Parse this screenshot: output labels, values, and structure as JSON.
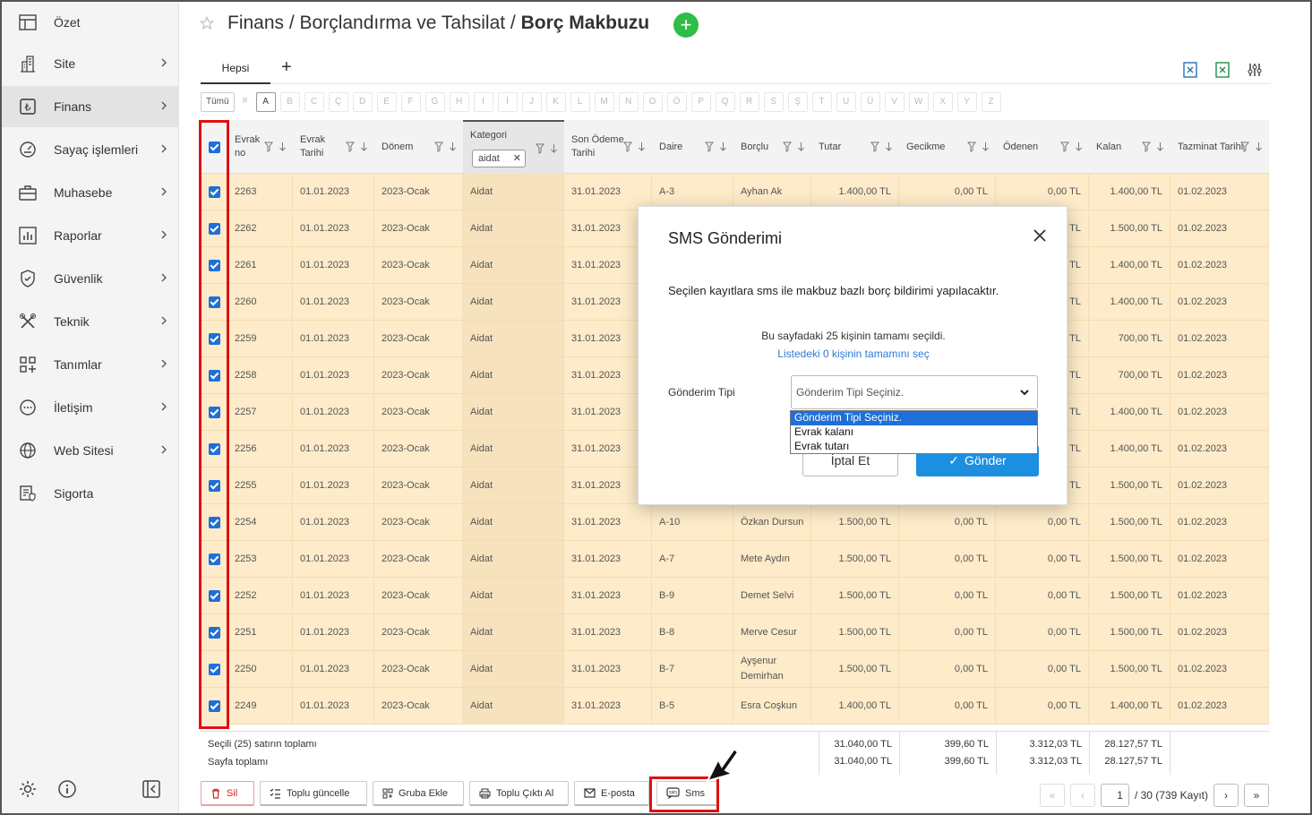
{
  "sidebar": {
    "items": [
      {
        "label": "Özet",
        "icon": "table-icon",
        "chevron": false,
        "active": false
      },
      {
        "label": "Site",
        "icon": "building-icon",
        "chevron": true,
        "active": false
      },
      {
        "label": "Finans",
        "icon": "lira-icon",
        "chevron": true,
        "active": true
      },
      {
        "label": "Sayaç işlemleri",
        "icon": "gauge-icon",
        "chevron": true,
        "active": false
      },
      {
        "label": "Muhasebe",
        "icon": "briefcase-icon",
        "chevron": true,
        "active": false
      },
      {
        "label": "Raporlar",
        "icon": "chart-icon",
        "chevron": true,
        "active": false
      },
      {
        "label": "Güvenlik",
        "icon": "shield-icon",
        "chevron": true,
        "active": false
      },
      {
        "label": "Teknik",
        "icon": "tools-icon",
        "chevron": true,
        "active": false
      },
      {
        "label": "Tanımlar",
        "icon": "grid-plus-icon",
        "chevron": true,
        "active": false
      },
      {
        "label": "İletişim",
        "icon": "chat-icon",
        "chevron": true,
        "active": false
      },
      {
        "label": "Web Sitesi",
        "icon": "globe-icon",
        "chevron": true,
        "active": false
      },
      {
        "label": "Sigorta",
        "icon": "insurance-icon",
        "chevron": false,
        "active": false
      }
    ]
  },
  "header": {
    "breadcrumb": "Finans / Borçlandırma ve Tahsilat / ",
    "current": "Borç Makbuzu",
    "add_symbol": "+"
  },
  "tabs": {
    "active": "Hepsi",
    "add": "+"
  },
  "letters": {
    "all": "Tümü",
    "hash": "#",
    "items": [
      "A",
      "B",
      "C",
      "Ç",
      "D",
      "E",
      "F",
      "G",
      "H",
      "I",
      "İ",
      "J",
      "K",
      "L",
      "M",
      "N",
      "O",
      "Ö",
      "P",
      "Q",
      "R",
      "S",
      "Ş",
      "T",
      "U",
      "Ü",
      "V",
      "W",
      "X",
      "Y",
      "Z"
    ]
  },
  "columns": {
    "evrak_no": "Evrak no",
    "evrak_tarihi": "Evrak Tarihi",
    "donem": "Dönem",
    "kategori": "Kategori",
    "kategori_filter": "aidat",
    "son_odeme": "Son Ödeme Tarihi",
    "daire": "Daire",
    "borclu": "Borçlu",
    "tutar": "Tutar",
    "gecikme": "Gecikme",
    "odenen": "Ödenen",
    "kalan": "Kalan",
    "tazminat": "Tazminat Tarihi"
  },
  "rows": [
    {
      "no": "2263",
      "tarih": "01.01.2023",
      "donem": "2023-Ocak",
      "kategori": "Aidat",
      "son": "31.01.2023",
      "daire": "A-3",
      "borclu": "Ayhan Ak",
      "tutar": "1.400,00 TL",
      "gecikme": "0,00 TL",
      "odenen": "0,00 TL",
      "kalan": "1.400,00 TL",
      "tazminat": "01.02.2023"
    },
    {
      "no": "2262",
      "tarih": "01.01.2023",
      "donem": "2023-Ocak",
      "kategori": "Aidat",
      "son": "31.01.2023",
      "daire": "",
      "borclu": "",
      "tutar": "",
      "gecikme": "",
      "odenen": "TL",
      "kalan": "1.500,00 TL",
      "tazminat": "01.02.2023"
    },
    {
      "no": "2261",
      "tarih": "01.01.2023",
      "donem": "2023-Ocak",
      "kategori": "Aidat",
      "son": "31.01.2023",
      "daire": "",
      "borclu": "",
      "tutar": "",
      "gecikme": "",
      "odenen": "TL",
      "kalan": "1.400,00 TL",
      "tazminat": "01.02.2023"
    },
    {
      "no": "2260",
      "tarih": "01.01.2023",
      "donem": "2023-Ocak",
      "kategori": "Aidat",
      "son": "31.01.2023",
      "daire": "",
      "borclu": "",
      "tutar": "",
      "gecikme": "",
      "odenen": "TL",
      "kalan": "1.400,00 TL",
      "tazminat": "01.02.2023"
    },
    {
      "no": "2259",
      "tarih": "01.01.2023",
      "donem": "2023-Ocak",
      "kategori": "Aidat",
      "son": "31.01.2023",
      "daire": "",
      "borclu": "",
      "tutar": "",
      "gecikme": "",
      "odenen": "TL",
      "kalan": "700,00 TL",
      "tazminat": "01.02.2023"
    },
    {
      "no": "2258",
      "tarih": "01.01.2023",
      "donem": "2023-Ocak",
      "kategori": "Aidat",
      "son": "31.01.2023",
      "daire": "",
      "borclu": "",
      "tutar": "",
      "gecikme": "",
      "odenen": "TL",
      "kalan": "700,00 TL",
      "tazminat": "01.02.2023"
    },
    {
      "no": "2257",
      "tarih": "01.01.2023",
      "donem": "2023-Ocak",
      "kategori": "Aidat",
      "son": "31.01.2023",
      "daire": "",
      "borclu": "",
      "tutar": "",
      "gecikme": "",
      "odenen": "TL",
      "kalan": "1.400,00 TL",
      "tazminat": "01.02.2023"
    },
    {
      "no": "2256",
      "tarih": "01.01.2023",
      "donem": "2023-Ocak",
      "kategori": "Aidat",
      "son": "31.01.2023",
      "daire": "",
      "borclu": "",
      "tutar": "",
      "gecikme": "",
      "odenen": "TL",
      "kalan": "1.400,00 TL",
      "tazminat": "01.02.2023"
    },
    {
      "no": "2255",
      "tarih": "01.01.2023",
      "donem": "2023-Ocak",
      "kategori": "Aidat",
      "son": "31.01.2023",
      "daire": "",
      "borclu": "",
      "tutar": "",
      "gecikme": "",
      "odenen": "TL",
      "kalan": "1.500,00 TL",
      "tazminat": "01.02.2023"
    },
    {
      "no": "2254",
      "tarih": "01.01.2023",
      "donem": "2023-Ocak",
      "kategori": "Aidat",
      "son": "31.01.2023",
      "daire": "A-10",
      "borclu": "Özkan Dursun",
      "tutar": "1.500,00 TL",
      "gecikme": "0,00 TL",
      "odenen": "0,00 TL",
      "kalan": "1.500,00 TL",
      "tazminat": "01.02.2023"
    },
    {
      "no": "2253",
      "tarih": "01.01.2023",
      "donem": "2023-Ocak",
      "kategori": "Aidat",
      "son": "31.01.2023",
      "daire": "A-7",
      "borclu": "Mete Aydın",
      "tutar": "1.500,00 TL",
      "gecikme": "0,00 TL",
      "odenen": "0,00 TL",
      "kalan": "1.500,00 TL",
      "tazminat": "01.02.2023"
    },
    {
      "no": "2252",
      "tarih": "01.01.2023",
      "donem": "2023-Ocak",
      "kategori": "Aidat",
      "son": "31.01.2023",
      "daire": "B-9",
      "borclu": "Demet Selvi",
      "tutar": "1.500,00 TL",
      "gecikme": "0,00 TL",
      "odenen": "0,00 TL",
      "kalan": "1.500,00 TL",
      "tazminat": "01.02.2023"
    },
    {
      "no": "2251",
      "tarih": "01.01.2023",
      "donem": "2023-Ocak",
      "kategori": "Aidat",
      "son": "31.01.2023",
      "daire": "B-8",
      "borclu": "Merve Cesur",
      "tutar": "1.500,00 TL",
      "gecikme": "0,00 TL",
      "odenen": "0,00 TL",
      "kalan": "1.500,00 TL",
      "tazminat": "01.02.2023"
    },
    {
      "no": "2250",
      "tarih": "01.01.2023",
      "donem": "2023-Ocak",
      "kategori": "Aidat",
      "son": "31.01.2023",
      "daire": "B-7",
      "borclu": "Ayşenur Demirhan",
      "tutar": "1.500,00 TL",
      "gecikme": "0,00 TL",
      "odenen": "0,00 TL",
      "kalan": "1.500,00 TL",
      "tazminat": "01.02.2023"
    },
    {
      "no": "2249",
      "tarih": "01.01.2023",
      "donem": "2023-Ocak",
      "kategori": "Aidat",
      "son": "31.01.2023",
      "daire": "B-5",
      "borclu": "Esra Coşkun",
      "tutar": "1.400,00 TL",
      "gecikme": "0,00 TL",
      "odenen": "0,00 TL",
      "kalan": "1.400,00 TL",
      "tazminat": "01.02.2023"
    }
  ],
  "totals": {
    "selected_label": "Seçili (25) satırın toplamı",
    "page_label": "Sayfa toplamı",
    "selected": {
      "tutar": "31.040,00 TL",
      "gecikme": "399,60 TL",
      "odenen": "3.312,03 TL",
      "kalan": "28.127,57 TL"
    },
    "page": {
      "tutar": "31.040,00 TL",
      "gecikme": "399,60 TL",
      "odenen": "3.312,03 TL",
      "kalan": "28.127,57 TL"
    }
  },
  "toolbar": {
    "sil": "Sil",
    "toplu_guncelle": "Toplu güncelle",
    "gruba_ekle": "Gruba Ekle",
    "toplu_cikti": "Toplu Çıktı Al",
    "eposta": "E-posta",
    "sms": "Sms"
  },
  "pager": {
    "page": "1",
    "info": "/ 30 (739 Kayıt)"
  },
  "modal": {
    "title": "SMS Gönderimi",
    "message": "Seçilen kayıtlara sms ile makbuz bazlı borç bildirimi yapılacaktır.",
    "info": "Bu sayfadaki 25 kişinin tamamı seçildi.",
    "link": "Listedeki 0 kişinin tamamını seç",
    "type_label": "Gönderim Tipi",
    "select_value": "Gönderim Tipi Seçiniz.",
    "options": [
      "Gönderim Tipi Seçiniz.",
      "Evrak kalanı",
      "Evrak tutarı"
    ],
    "cancel": "İptal Et",
    "send": "Gönder"
  },
  "colors": {
    "row_bg": "#fdebc9",
    "accent": "#1c8fe0",
    "highlight": "#e01010",
    "add": "#2ebd47"
  }
}
